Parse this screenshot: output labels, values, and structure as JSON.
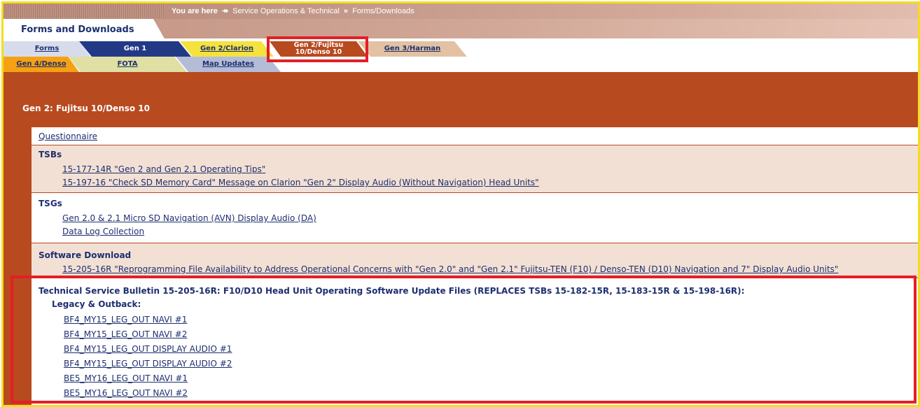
{
  "breadcrumb": {
    "prefix": "You are here",
    "arrow": "»",
    "items": [
      "Service Operations & Technical",
      "Forms/Downloads"
    ],
    "sep": "»"
  },
  "page_tab": "Forms and Downloads",
  "tabs": {
    "forms": "Forms",
    "gen1": "Gen 1",
    "gen2_clarion": "Gen 2/Clarion",
    "gen2_fujitsu_line1": "Gen 2/Fujitsu",
    "gen2_fujitsu_line2": "10/Denso 10",
    "gen3_harman": "Gen 3/Harman",
    "gen4_denso": "Gen 4/Denso",
    "fota": "FOTA",
    "map_updates": "Map Updates"
  },
  "section_title": "Gen 2: Fujitsu 10/Denso 10",
  "questionnaire": "Questionnaire",
  "tsbs": {
    "heading": "TSBs",
    "links": [
      "15-177-14R \"Gen 2 and Gen 2.1 Operating Tips\"",
      "15-197-16 \"Check SD Memory Card\" Message on Clarion \"Gen 2\" Display Audio (Without Navigation) Head Units\""
    ]
  },
  "tsgs": {
    "heading": "TSGs",
    "links": [
      "Gen 2.0 & 2.1 Micro SD Navigation (AVN) Display Audio (DA)",
      "Data Log Collection"
    ]
  },
  "software": {
    "heading": "Software Download",
    "links": [
      "15-205-16R \"Reprogramming File Availability to Address Operational Concerns with \"Gen 2.0\" and \"Gen 2.1\" Fujitsu-TEN (F10) / Denso-TEN (D10) Navigation and 7\" Display Audio Units\""
    ]
  },
  "technical": {
    "heading": "Technical Service Bulletin 15-205-16R: F10/D10 Head Unit Operating Software Update Files (REPLACES TSBs 15-182-15R, 15-183-15R & 15-198-16R):",
    "subheading": "Legacy & Outback:",
    "links": [
      "BF4_MY15_LEG_OUT NAVI #1",
      "BF4_MY15_LEG_OUT NAVI #2",
      "BF4_MY15_LEG_OUT DISPLAY AUDIO #1",
      "BF4_MY15_LEG_OUT DISPLAY AUDIO #2",
      "BE5_MY16_LEG_OUT NAVI #1",
      "BE5_MY16_LEG_OUT NAVI #2"
    ]
  },
  "colors": {
    "accent_brown": "#b84a1f",
    "link_navy": "#1d2f6f",
    "highlight_red": "#e41e26",
    "frame_yellow": "#f4dd1c"
  }
}
